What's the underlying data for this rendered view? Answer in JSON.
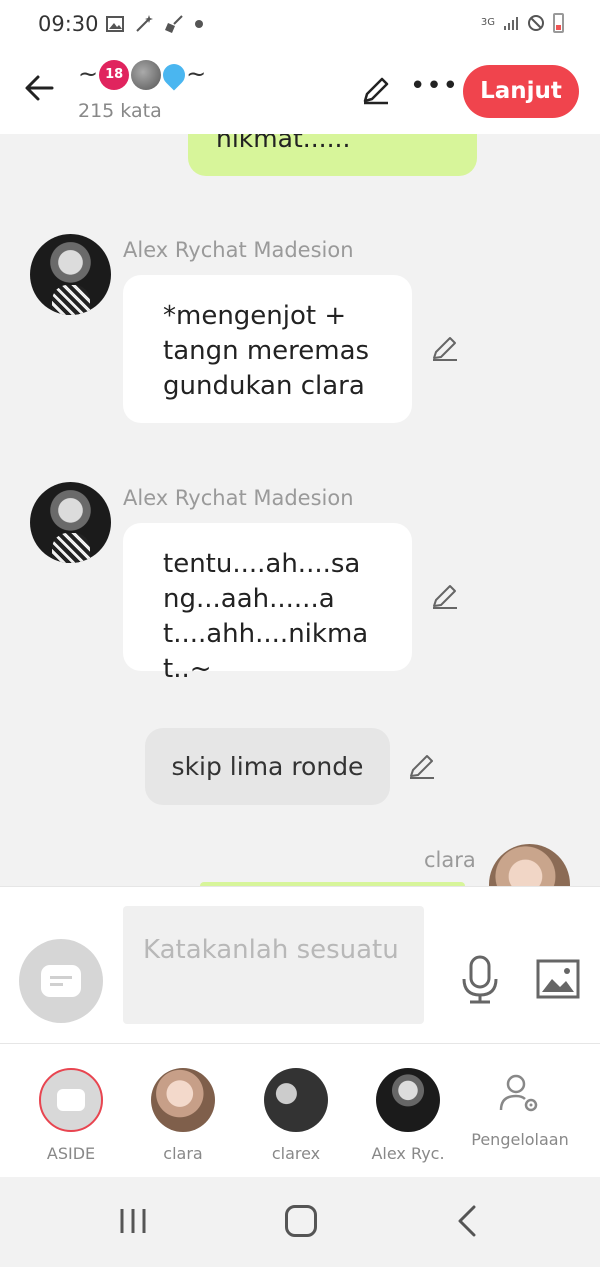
{
  "status_bar": {
    "time": "09:30",
    "icons": [
      "gallery-icon",
      "magic-wand-icon",
      "broom-icon",
      "dot-icon"
    ],
    "network": "3G",
    "right_icons": [
      "signal-icon",
      "do-not-disturb-icon",
      "battery-icon"
    ]
  },
  "header": {
    "title_prefix": "~",
    "title_emojis": [
      "no-under-18-emoji",
      "new-moon-face-emoji",
      "sweat-droplets-emoji"
    ],
    "title_suffix": "~",
    "emoji_18_text": "18",
    "subtitle": "215 kata",
    "continue_label": "Lanjut",
    "more_label": "•••",
    "accent_color": "#f0444d"
  },
  "chat": {
    "top_fragment": "nikmat......",
    "messages": [
      {
        "sender": "Alex Rychat Madesion",
        "text": "*mengenjot + tangn meremas gundukan clara"
      },
      {
        "sender": "Alex Rychat Madesion",
        "text": "tentu....ah....sang...aah......at....ahh....nikmat..~"
      }
    ],
    "narration": "skip lima ronde",
    "last_sender": "clara",
    "bubble_green": "#d7f59a"
  },
  "input": {
    "placeholder": "Katakanlah sesuatu"
  },
  "tabs": [
    {
      "label": "ASIDE"
    },
    {
      "label": "clara"
    },
    {
      "label": "clarex"
    },
    {
      "label": "Alex Ryc."
    },
    {
      "label": "Pengelolaan"
    }
  ]
}
